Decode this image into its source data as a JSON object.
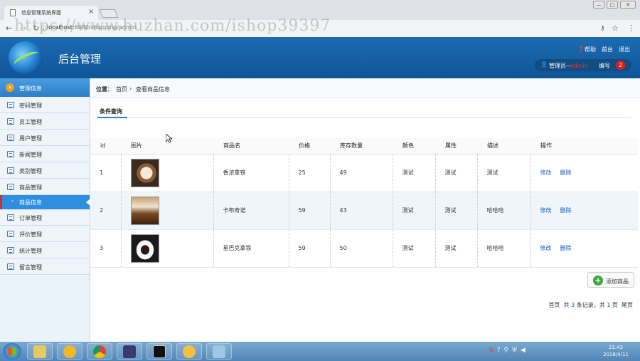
{
  "browser": {
    "tab_title": "信息管理系统界面",
    "tab_close": "×",
    "url_host": "localhost:",
    "url_path": "8080/shopping/admin",
    "watermark": "https://www.huzhan.com/ishop39397",
    "window_buttons": {
      "minimize": "—",
      "maximize": "□",
      "close": "✕"
    }
  },
  "header": {
    "title": "后台管理",
    "links": {
      "help": "帮助",
      "home": "前台",
      "logout": "退出"
    },
    "user_prefix": "管理员--",
    "user_name": "admin",
    "number_label": "编号",
    "number_badge": "2"
  },
  "sidebar": {
    "section_title": "管理信息",
    "items": [
      {
        "label": "密码管理"
      },
      {
        "label": "员工管理"
      },
      {
        "label": "用户管理"
      },
      {
        "label": "新闻管理"
      },
      {
        "label": "类别管理"
      },
      {
        "label": "商品管理"
      }
    ],
    "active_sub": "商品信息",
    "items_after": [
      {
        "label": "订单管理"
      },
      {
        "label": "评价管理"
      },
      {
        "label": "统计管理"
      },
      {
        "label": "留言管理"
      }
    ]
  },
  "breadcrumb": {
    "label": "位置：",
    "home": "首页",
    "sep": "›",
    "current": "查看商品信息"
  },
  "search": {
    "tab_label": "条件查询"
  },
  "table": {
    "headers": [
      "id",
      "图片",
      "商品名",
      "价格",
      "库存数量",
      "颜色",
      "属性",
      "描述",
      "操作"
    ],
    "rows": [
      {
        "id": "1",
        "name": "香浓拿铁",
        "price": "25",
        "stock": "49",
        "color": "测试",
        "attr": "测试",
        "desc": "测试",
        "edit": "修改",
        "delete": "删除"
      },
      {
        "id": "2",
        "name": "卡布奇诺",
        "price": "59",
        "stock": "43",
        "color": "测试",
        "attr": "测试",
        "desc": "哈哈哈",
        "edit": "修改",
        "delete": "删除"
      },
      {
        "id": "3",
        "name": "星巴克拿铁",
        "price": "59",
        "stock": "50",
        "color": "测试",
        "attr": "测试",
        "desc": "哈哈哈",
        "edit": "修改",
        "delete": "删除"
      }
    ]
  },
  "add_button": {
    "label": "添加商品"
  },
  "pager": {
    "first": "首页",
    "total_pre": "共",
    "total_count": "3",
    "total_mid": "条记录，共",
    "page_count": "1",
    "total_post": "页",
    "last": "尾页"
  },
  "taskbar": {
    "time": "21:43",
    "date": "2018/4/11"
  },
  "colors": {
    "header": "#1c6bb3",
    "sidebar_active": "#2e8ee0",
    "link": "#1a5ac2",
    "badge": "#d42020"
  }
}
